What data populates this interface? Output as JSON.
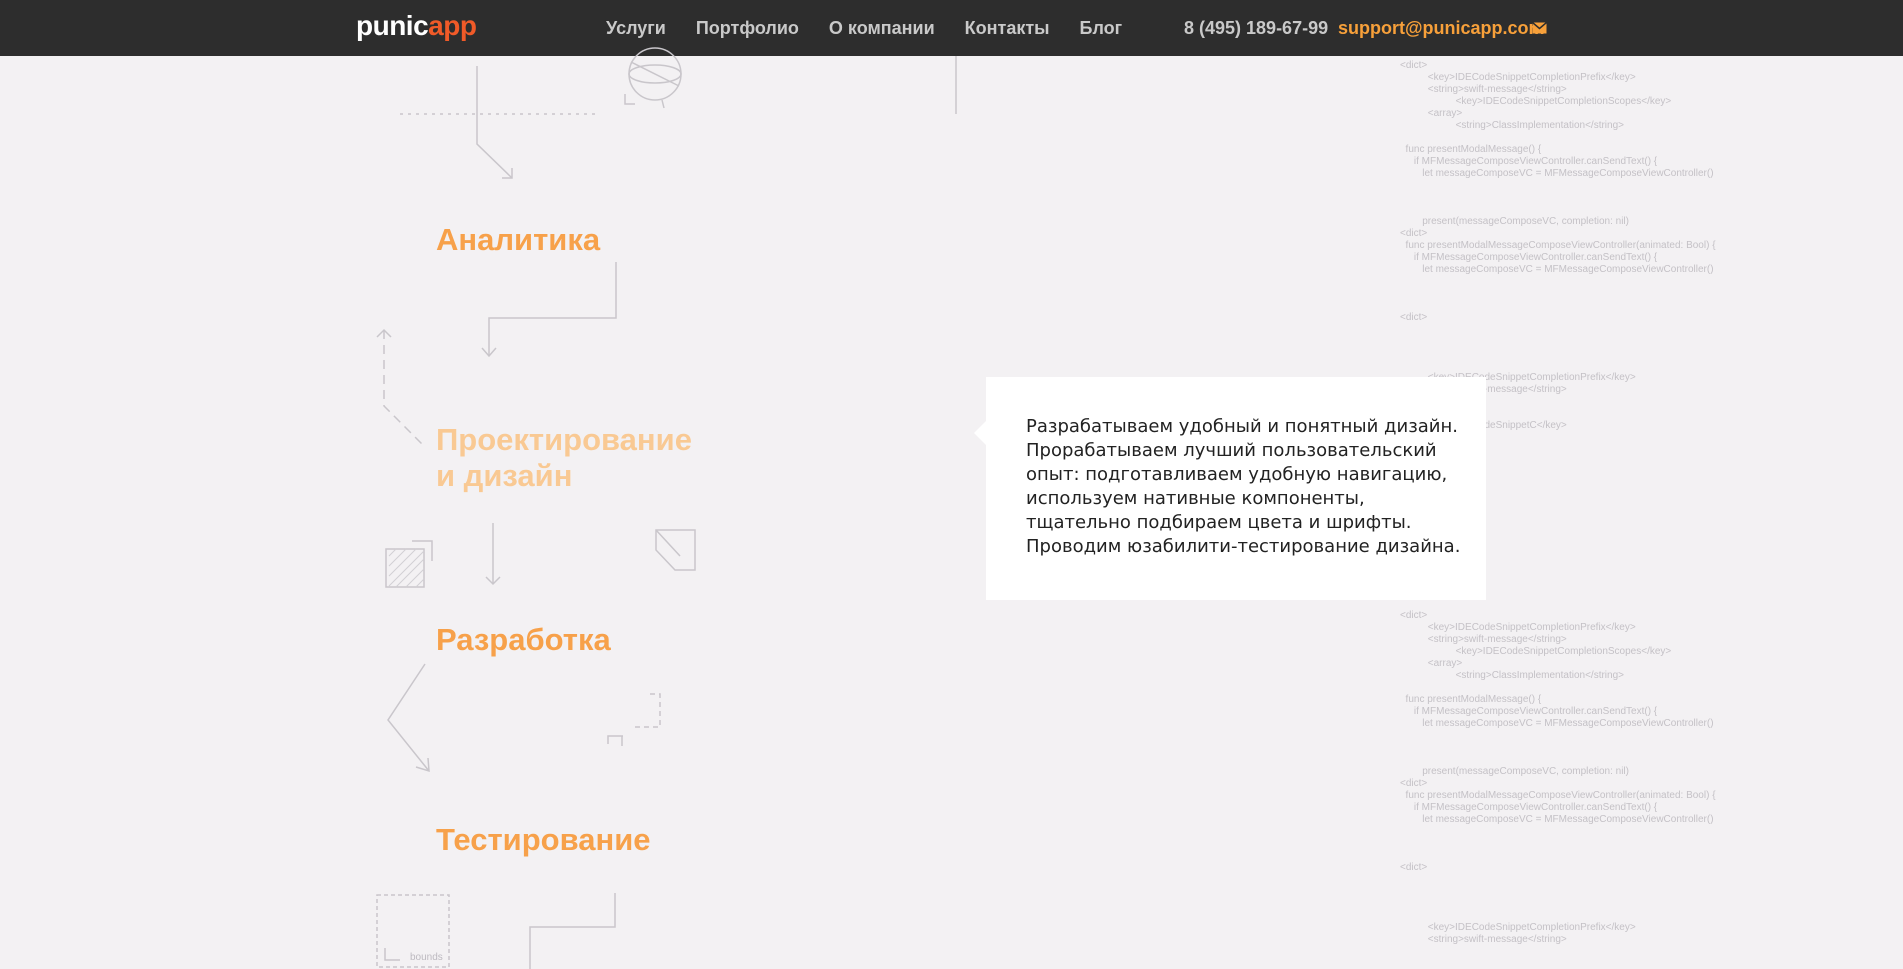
{
  "header": {
    "logo_part1": "punic",
    "logo_part2": "app",
    "nav": [
      "Услуги",
      "Портфолио",
      "О компании",
      "Контакты",
      "Блог"
    ],
    "phone": "8 (495) 189-67-99",
    "email": "support@punicapp.com",
    "mail_icon": "envelope-icon"
  },
  "steps": [
    {
      "lines": [
        "Аналитика"
      ]
    },
    {
      "lines": [
        "Проектирование",
        "и дизайн"
      ]
    },
    {
      "lines": [
        "Разработка"
      ]
    },
    {
      "lines": [
        "Тестирование"
      ]
    }
  ],
  "popover": {
    "lines": [
      "Разрабатываем удобный и понятный дизайн.",
      "Прорабатываем лучший пользовательский",
      "опыт: подготавливаем удобную навигацию,",
      "используем нативные компоненты,",
      "тщательно подбираем цвета и шрифты.",
      "Проводим юзабилити-тестирование дизайна."
    ]
  },
  "decoration": {
    "bounds_label": "bounds"
  },
  "code_blocks": [
    {
      "rows": [
        "<dict>",
        "          <key>IDECodeSnippetCompletionPrefix</key>",
        "          <string>swift-message</string>",
        "                    <key>IDECodeSnippetCompletionScopes</key>",
        "          <array>",
        "                    <string>ClassImplementation</string>",
        "",
        "  func presentModalMessage() {",
        "     if MFMessageComposeViewController.canSendText() {",
        "        let messageComposeVC = MFMessageComposeViewController()",
        "",
        "",
        "",
        "        present(messageComposeVC, completion: nil)",
        "<dict>",
        "  func presentModalMessageComposeViewController(animated: Bool) {",
        "     if MFMessageComposeViewController.canSendText() {",
        "        let messageComposeVC = MFMessageComposeViewController()",
        "",
        "",
        "",
        "<dict>"
      ]
    },
    {
      "rows": [
        "          <key>IDECodeSnippetCompletionPrefix</key>",
        "          <string>swift-message</string>",
        "",
        "",
        "          <key>IDECodeSnippetC</key>"
      ]
    },
    {
      "rows": [
        "<dict>",
        "          <key>IDECodeSnippetCompletionPrefix</key>",
        "          <string>swift-message</string>",
        "                    <key>IDECodeSnippetCompletionScopes</key>",
        "          <array>",
        "                    <string>ClassImplementation</string>",
        "",
        "  func presentModalMessage() {",
        "     if MFMessageComposeViewController.canSendText() {",
        "        let messageComposeVC = MFMessageComposeViewController()",
        "",
        "",
        "",
        "        present(messageComposeVC, completion: nil)",
        "<dict>",
        "  func presentModalMessageComposeViewController(animated: Bool) {",
        "     if MFMessageComposeViewController.canSendText() {",
        "        let messageComposeVC = MFMessageComposeViewController()",
        "",
        "",
        "",
        "<dict>",
        "",
        "",
        "",
        "",
        "          <key>IDECodeSnippetCompletionPrefix</key>",
        "          <string>swift-message</string>"
      ]
    }
  ]
}
